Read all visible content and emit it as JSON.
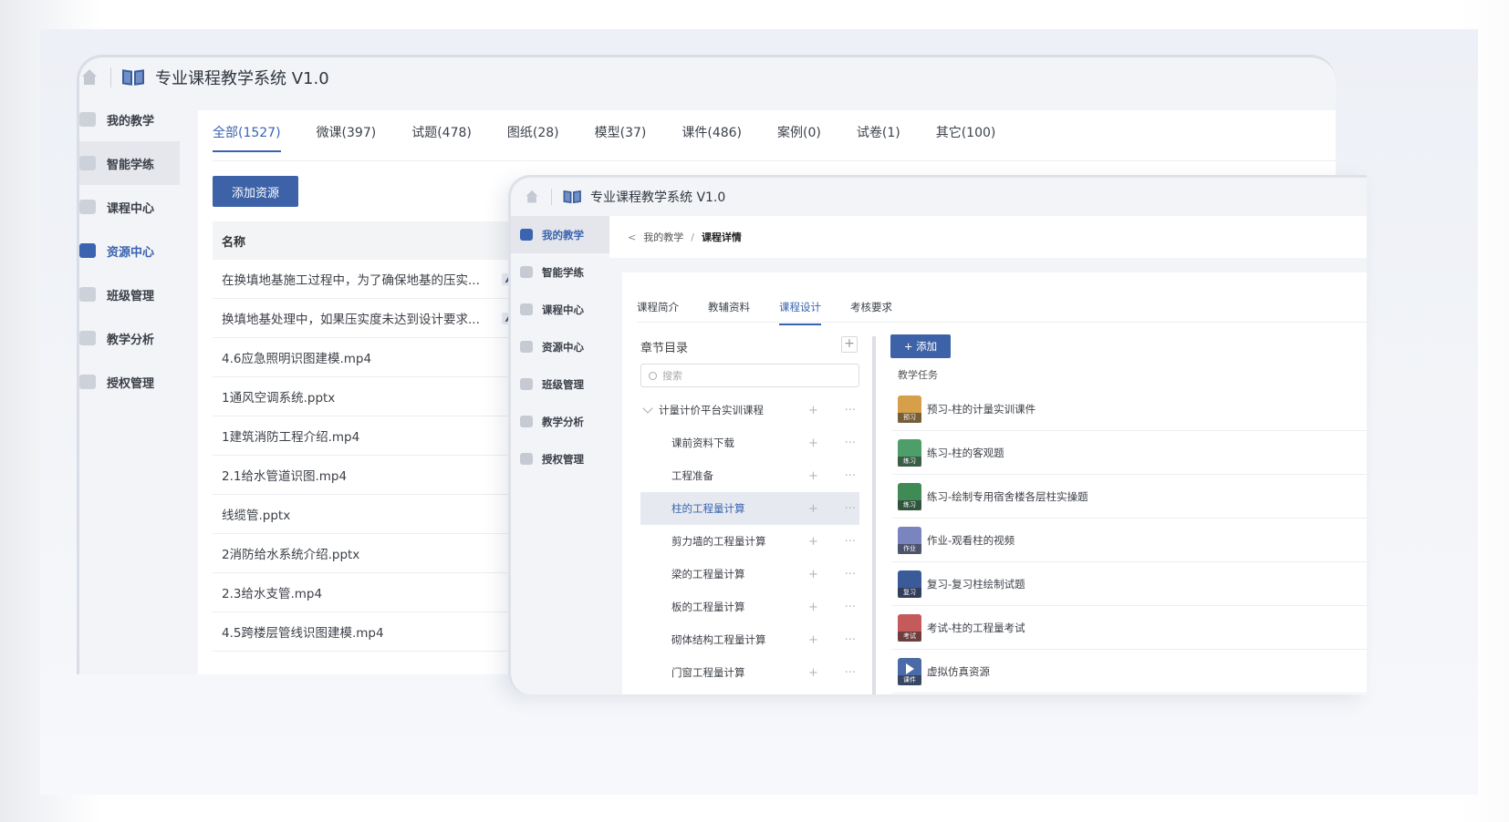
{
  "app": {
    "title": "专业课程教学系统  V1.0"
  },
  "back_window": {
    "sidebar": [
      {
        "label": "我的教学",
        "state": ""
      },
      {
        "label": "智能学练",
        "state": "soft"
      },
      {
        "label": "课程中心",
        "state": ""
      },
      {
        "label": "资源中心",
        "state": "active"
      },
      {
        "label": "班级管理",
        "state": ""
      },
      {
        "label": "教学分析",
        "state": ""
      },
      {
        "label": "授权管理",
        "state": ""
      }
    ],
    "tabs": [
      "全部(1527)",
      "微课(397)",
      "试题(478)",
      "图纸(28)",
      "模型(37)",
      "课件(486)",
      "案例(0)",
      "试卷(1)",
      "其它(100)"
    ],
    "add_button": "添加资源",
    "table_header": "名称",
    "rows": [
      {
        "name": "在换填地基施工过程中，为了确保地基的压实...",
        "ai": "AI"
      },
      {
        "name": "换填地基处理中，如果压实度未达到设计要求...",
        "ai": "AI"
      },
      {
        "name": "4.6应急照明识图建模.mp4",
        "ai": ""
      },
      {
        "name": "1通风空调系统.pptx",
        "ai": ""
      },
      {
        "name": "1建筑消防工程介绍.mp4",
        "ai": ""
      },
      {
        "name": "2.1给水管道识图.mp4",
        "ai": ""
      },
      {
        "name": "线缆管.pptx",
        "ai": ""
      },
      {
        "name": "2消防给水系统介绍.pptx",
        "ai": ""
      },
      {
        "name": "2.3给水支管.mp4",
        "ai": ""
      },
      {
        "name": "4.5跨楼层管线识图建模.mp4",
        "ai": ""
      }
    ]
  },
  "front_window": {
    "sidebar": [
      {
        "label": "我的教学",
        "state": "active"
      },
      {
        "label": "智能学练",
        "state": ""
      },
      {
        "label": "课程中心",
        "state": ""
      },
      {
        "label": "资源中心",
        "state": ""
      },
      {
        "label": "班级管理",
        "state": ""
      },
      {
        "label": "教学分析",
        "state": ""
      },
      {
        "label": "授权管理",
        "state": ""
      }
    ],
    "breadcrumb": {
      "back": "<",
      "parent": "我的教学",
      "sep": "/",
      "current": "课程详情"
    },
    "tabs": [
      "课程简介",
      "教辅资料",
      "课程设计",
      "考核要求"
    ],
    "active_tab": 2,
    "chapter": {
      "title": "章节目录",
      "search_placeholder": "搜索",
      "nodes": [
        {
          "label": "计量计价平台实训课程",
          "type": "root",
          "selected": false
        },
        {
          "label": "课前资料下载",
          "type": "child",
          "selected": false
        },
        {
          "label": "工程准备",
          "type": "child",
          "selected": false
        },
        {
          "label": "柱的工程量计算",
          "type": "child",
          "selected": true
        },
        {
          "label": "剪力墙的工程量计算",
          "type": "child",
          "selected": false
        },
        {
          "label": "梁的工程量计算",
          "type": "child",
          "selected": false
        },
        {
          "label": "板的工程量计算",
          "type": "child",
          "selected": false
        },
        {
          "label": "砌体结构工程量计算",
          "type": "child",
          "selected": false
        },
        {
          "label": "门窗工程量计算",
          "type": "child",
          "selected": false
        }
      ]
    },
    "add_button": "+  添加",
    "tasks_title": "教学任务",
    "tasks": [
      {
        "tag": "预习",
        "label": "预习-柱的计量实训课件",
        "color": "#d6a04a"
      },
      {
        "tag": "练习",
        "label": "练习-柱的客观题",
        "color": "#4e9e6a"
      },
      {
        "tag": "练习",
        "label": "练习-绘制专用宿舍楼各层柱实操题",
        "color": "#3f8a55"
      },
      {
        "tag": "作业",
        "label": "作业-观看柱的视频",
        "color": "#7a85c0"
      },
      {
        "tag": "复习",
        "label": "复习-复习柱绘制试题",
        "color": "#3a5a9a"
      },
      {
        "tag": "考试",
        "label": "考试-柱的工程量考试",
        "color": "#c45a5a"
      },
      {
        "tag": "课件",
        "label": "虚拟仿真资源",
        "color": "#4a6aa8",
        "play": true
      }
    ]
  }
}
